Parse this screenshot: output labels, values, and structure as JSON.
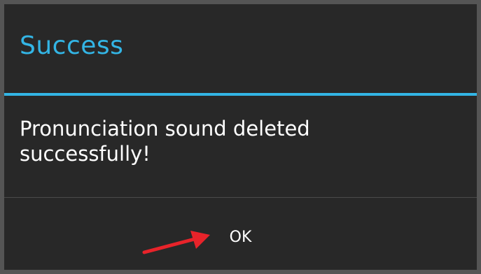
{
  "dialog": {
    "title": "Success",
    "message": "Pronunciation sound deleted successfully!",
    "ok_label": "OK"
  },
  "colors": {
    "accent": "#33b5e5",
    "dialog_background": "#282828",
    "arrow": "#e8232a"
  }
}
